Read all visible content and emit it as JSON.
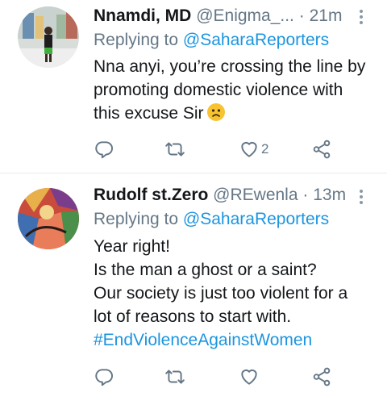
{
  "tweets": [
    {
      "name": "Nnamdi, MD",
      "handle": "@Enigma_...",
      "dot": "·",
      "time": "21m",
      "reply_prefix": "Replying to",
      "reply_to": "@SaharaReporters",
      "lines": [
        "Nna anyi, you’re crossing the line by",
        "promoting domestic violence with",
        "this excuse Sir"
      ],
      "emoji": "worried-face",
      "hashtag": "",
      "like_count": "2"
    },
    {
      "name": "Rudolf st.Zero",
      "handle": "@REwenla",
      "dot": "·",
      "time": "13m",
      "reply_prefix": "Replying to",
      "reply_to": "@SaharaReporters",
      "lines": [
        "Year right!",
        "Is the man a ghost or a saint?",
        "Our society is just too violent for a",
        "lot of reasons to start with."
      ],
      "hashtag": "#EndViolenceAgainstWomen",
      "like_count": ""
    }
  ],
  "colors": {
    "link": "#1b95e0",
    "muted": "#657786",
    "divider": "#e6ecf0"
  },
  "icons": [
    "reply-icon",
    "retweet-icon",
    "like-icon",
    "share-icon",
    "more-icon"
  ]
}
